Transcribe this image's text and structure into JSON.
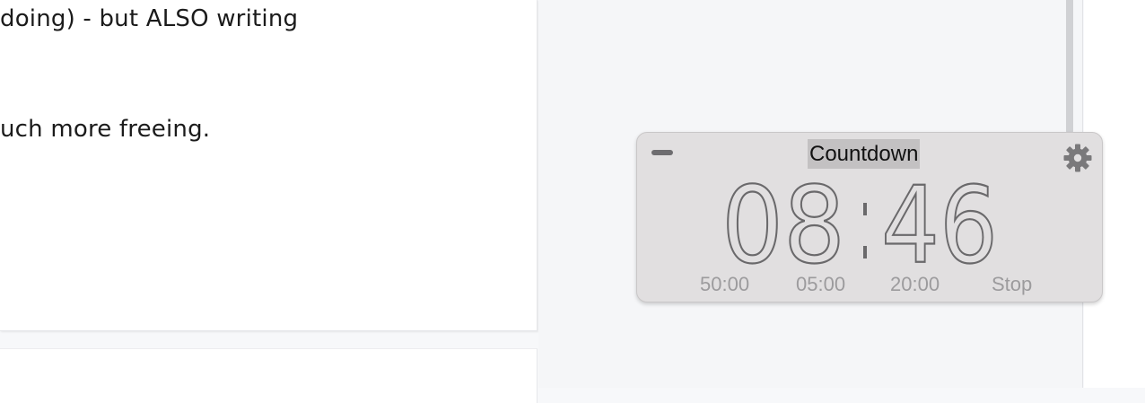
{
  "document": {
    "line_1": "doing) - but ALSO writing",
    "line_2": "uch more freeing."
  },
  "countdown": {
    "title": "Countdown",
    "time": "08:46",
    "minutes": "08",
    "seconds": "46",
    "presets": [
      "50:00",
      "05:00",
      "20:00",
      "Stop"
    ],
    "minimize_icon": "minus-icon",
    "settings_icon": "gear-icon"
  },
  "colors": {
    "widget_background": "#e1dfe0",
    "title_highlight": "#c3c1c2",
    "clock_digits": "#6a696b",
    "preset_text": "#9c9b9d"
  }
}
